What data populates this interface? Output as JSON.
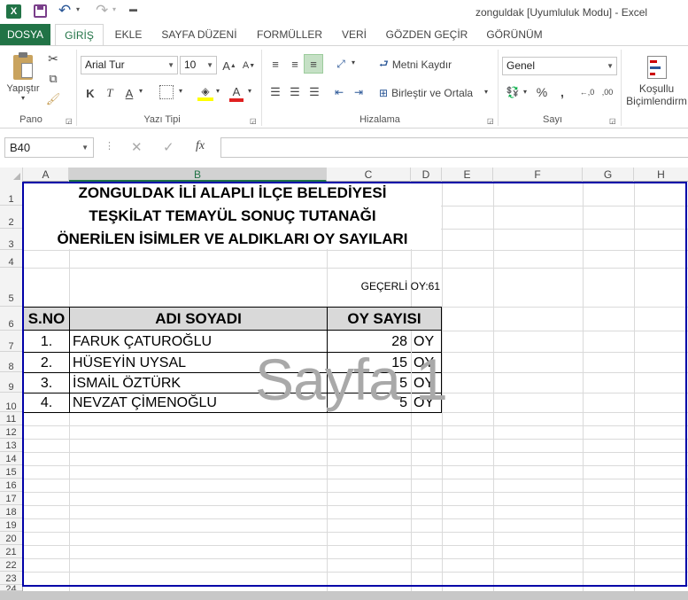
{
  "window": {
    "title": "zonguldak  [Uyumluluk Modu] - Excel"
  },
  "tabs": [
    "DOSYA",
    "GİRİŞ",
    "EKLE",
    "SAYFA DÜZENİ",
    "FORMÜLLER",
    "VERİ",
    "GÖZDEN GEÇİR",
    "GÖRÜNÜM"
  ],
  "ribbon": {
    "paste_label": "Yapıştır",
    "font_name": "Arial Tur",
    "font_size": "10",
    "bold": "K",
    "italic": "T",
    "underline": "A",
    "wrap_text": "Metni Kaydır",
    "merge_center": "Birleştir ve Ortala",
    "number_format": "Genel",
    "cond_format_line1": "Koşullu",
    "cond_format_line2": "Biçimlendirm",
    "groups": {
      "clipboard": "Pano",
      "font": "Yazı Tipi",
      "alignment": "Hizalama",
      "number": "Sayı"
    }
  },
  "formula_bar": {
    "name_box": "B40",
    "fx": "fx",
    "value": ""
  },
  "columns": [
    "A",
    "B",
    "C",
    "D",
    "E",
    "F",
    "G",
    "H"
  ],
  "rows": [
    "1",
    "2",
    "3",
    "4",
    "5",
    "6",
    "7",
    "8",
    "9",
    "10",
    "11",
    "12",
    "13",
    "14",
    "15",
    "16",
    "17",
    "18",
    "19",
    "20",
    "21",
    "22",
    "23",
    "24"
  ],
  "sheet": {
    "title1": "ZONGULDAK İLİ ALAPLI İLÇE BELEDİYESİ",
    "title2": "TEŞKİLAT TEMAYÜL SONUÇ TUTANAĞI",
    "title3": "ÖNERİLEN İSİMLER VE ALDIKLARI OY SAYILARI",
    "valid_votes": "GEÇERLİ OY:61",
    "headers": {
      "no": "S.NO",
      "name": "ADI SOYADI",
      "votes": "OY SAYISI"
    },
    "rows": [
      {
        "no": "1.",
        "name": "FARUK ÇATUROĞLU",
        "votes": "28",
        "unit": "OY"
      },
      {
        "no": "2.",
        "name": "HÜSEYİN UYSAL",
        "votes": "15",
        "unit": "OY"
      },
      {
        "no": "3.",
        "name": "İSMAİL ÖZTÜRK",
        "votes": "5",
        "unit": "OY"
      },
      {
        "no": "4.",
        "name": "NEVZAT ÇİMENOĞLU",
        "votes": "5",
        "unit": "OY"
      }
    ],
    "watermark": "Sayfa 1"
  },
  "colors": {
    "excel_green": "#217346",
    "print_area": "#0000a8",
    "header_fill": "#d9d9d9"
  }
}
